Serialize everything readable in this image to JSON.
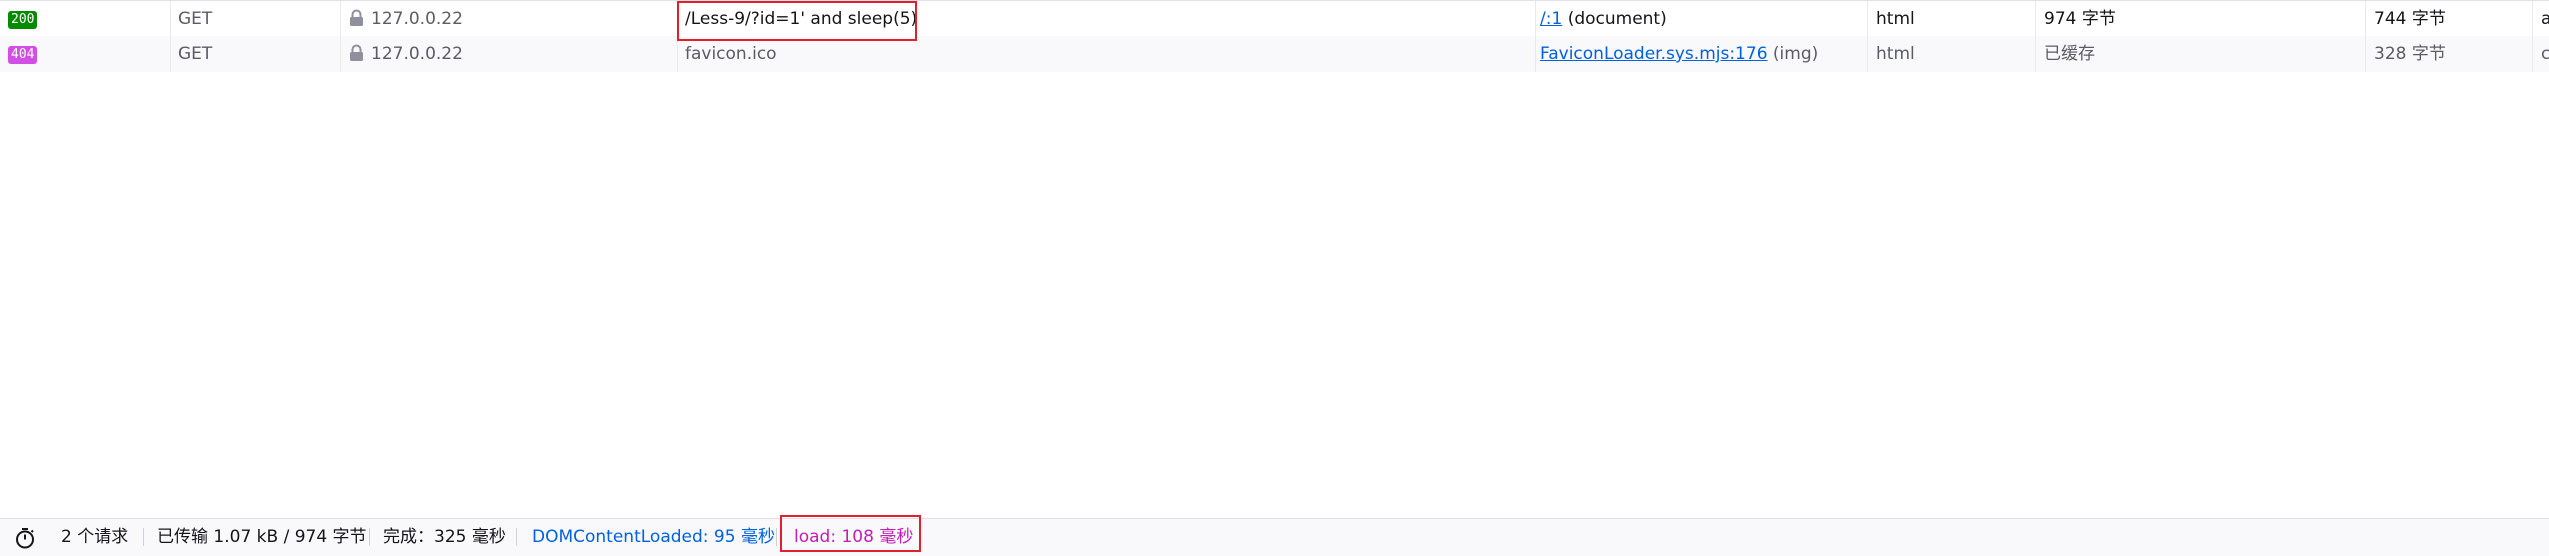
{
  "requests": [
    {
      "status": "200",
      "status_color": "#058b00",
      "method": "GET",
      "domain": "127.0.0.22",
      "file": "/Less-9/?id=1' and sleep(5)",
      "initiator_link": "/:1",
      "initiator_type": "(document)",
      "type": "html",
      "transferred": "974 字节",
      "size": "744 字节",
      "extra": "a"
    },
    {
      "status": "404",
      "status_color": "#d24fe6",
      "method": "GET",
      "domain": "127.0.0.22",
      "file": "favicon.ico",
      "initiator_link": "FaviconLoader.sys.mjs:176",
      "initiator_type": "(img)",
      "type": "html",
      "transferred": "已缓存",
      "size": "328 字节",
      "extra": "c"
    }
  ],
  "summary": {
    "requests": "2 个请求",
    "transferred": "已传输 1.07 kB / 974 字节",
    "finish": "完成：325 毫秒",
    "dom_content_loaded": "DOMContentLoaded: 95 毫秒",
    "load": "load: 108 毫秒"
  },
  "colors": {
    "highlight_box": "#e0202c",
    "dom_content_loaded": "#0060df",
    "load": "#c51cb5",
    "link": "#0060df"
  },
  "icons": {
    "secure": "lock-icon",
    "timer": "stopwatch-icon"
  }
}
